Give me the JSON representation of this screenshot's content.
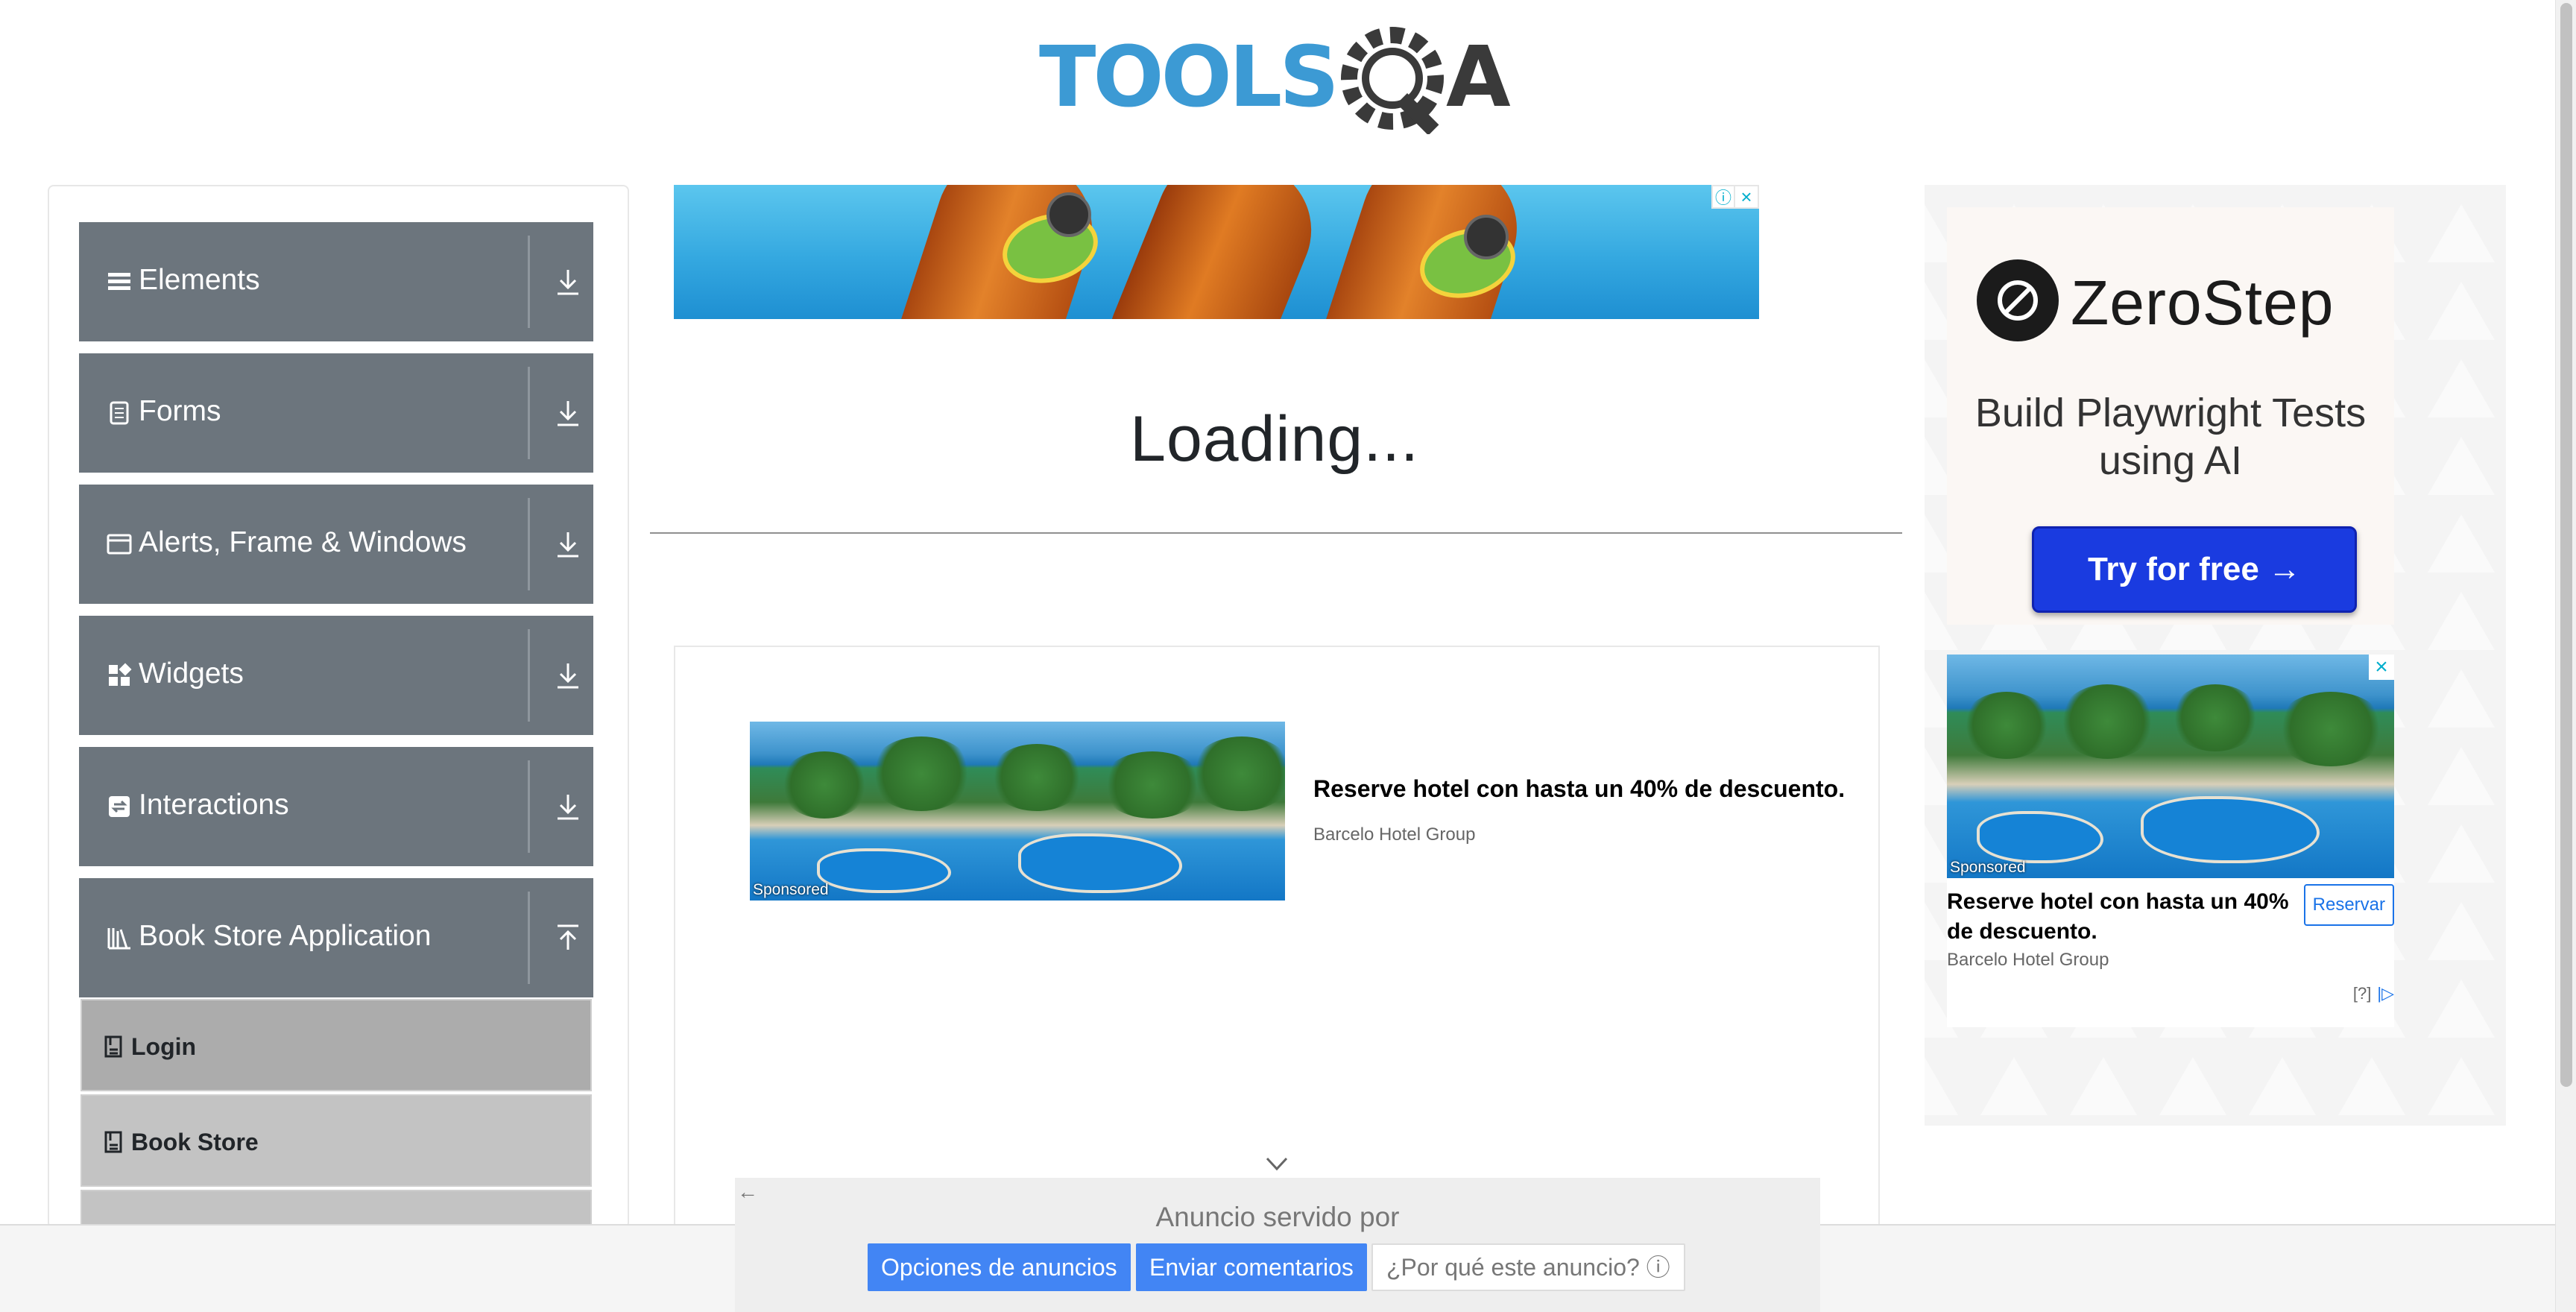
{
  "header": {
    "logo_text_left": "TOOLS",
    "logo_text_right": "A"
  },
  "sidebar": {
    "groups": [
      {
        "label": "Elements",
        "icon": "list-icon"
      },
      {
        "label": "Forms",
        "icon": "form-icon"
      },
      {
        "label": "Alerts, Frame & Windows",
        "icon": "window-icon"
      },
      {
        "label": "Widgets",
        "icon": "widgets-icon"
      },
      {
        "label": "Interactions",
        "icon": "interactions-icon"
      },
      {
        "label": "Book Store Application",
        "icon": "book-store-icon"
      }
    ],
    "subitems": [
      {
        "label": "Login",
        "icon": "book-icon"
      },
      {
        "label": "Book Store",
        "icon": "book-icon"
      }
    ]
  },
  "main": {
    "loading_text": "Loading..."
  },
  "mid_ad": {
    "sponsored": "Sponsored",
    "title": "Reserve hotel con hasta un 40% de descuento.",
    "advertiser": "Barcelo Hotel Group"
  },
  "footer_ad": {
    "served_by": "Anuncio servido por",
    "options_button": "Opciones de anuncios",
    "feedback_button": "Enviar comentarios",
    "why_button": "¿Por qué este anuncio? ⓘ"
  },
  "right_ad": {
    "brand": "ZeroStep",
    "tagline": "Build Playwright Tests using AI",
    "cta": "Try for free →",
    "sponsored": "Sponsored",
    "title": "Reserve hotel con hasta un 40% de descuento.",
    "advertiser": "Barcelo Hotel Group",
    "reserve_button": "Reservar",
    "info": "[?]"
  },
  "colors": {
    "sidebar_group_bg": "#6c757d",
    "sidebar_active_bg": "#acacac",
    "ad_button_blue": "#4285f4",
    "zerostep_button": "#1a3be0"
  }
}
